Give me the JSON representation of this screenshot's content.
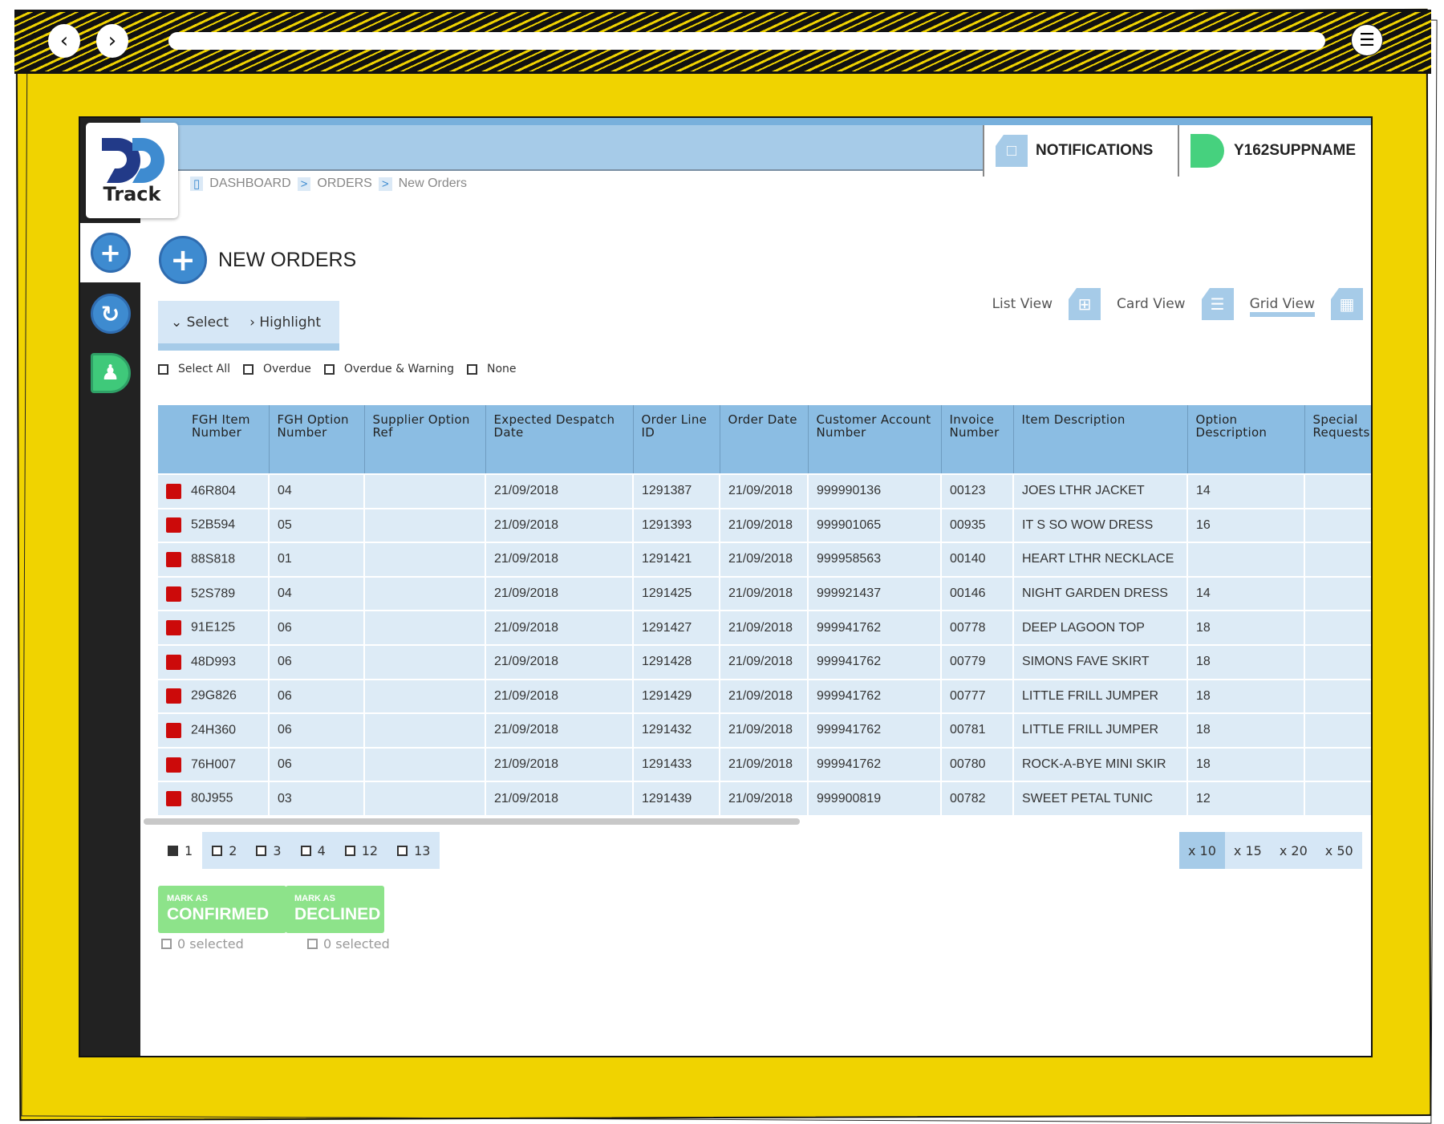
{
  "browser": {
    "back_icon": "chevron-left",
    "forward_icon": "chevron-right",
    "menu_icon": "hamburger"
  },
  "header": {
    "logo_text": "Track",
    "notifications_label": "NOTIFICATIONS",
    "user_label": "Y162SUPPNAME"
  },
  "breadcrumb": [
    "DASHBOARD",
    "ORDERS",
    "New Orders"
  ],
  "page": {
    "title": "NEW ORDERS"
  },
  "toolbar": {
    "select_label": "Select",
    "highlight_label": "Highlight"
  },
  "filters": [
    "Select All",
    "Overdue",
    "Overdue & Warning",
    "None"
  ],
  "views": [
    {
      "label": "List View",
      "active": false
    },
    {
      "label": "Card View",
      "active": false
    },
    {
      "label": "Grid View",
      "active": true
    }
  ],
  "table": {
    "columns": [
      "FGH Item Number",
      "FGH Option Number",
      "Supplier Option Ref",
      "Expected Despatch Date",
      "Order Line ID",
      "Order Date",
      "Customer Account Number",
      "Invoice Number",
      "Item Description",
      "Option Description",
      "Special Requests"
    ],
    "flag_color": "#cc0a0a",
    "rows": [
      [
        "46R804",
        "04",
        "",
        "21/09/2018",
        "1291387",
        "21/09/2018",
        "999990136",
        "00123",
        "JOES LTHR JACKET",
        "14",
        ""
      ],
      [
        "52B594",
        "05",
        "",
        "21/09/2018",
        "1291393",
        "21/09/2018",
        "999901065",
        "00935",
        "IT S SO WOW DRESS",
        "16",
        ""
      ],
      [
        "88S818",
        "01",
        "",
        "21/09/2018",
        "1291421",
        "21/09/2018",
        "999958563",
        "00140",
        "HEART LTHR NECKLACE",
        "",
        ""
      ],
      [
        "52S789",
        "04",
        "",
        "21/09/2018",
        "1291425",
        "21/09/2018",
        "999921437",
        "00146",
        "NIGHT GARDEN DRESS",
        "14",
        ""
      ],
      [
        "91E125",
        "06",
        "",
        "21/09/2018",
        "1291427",
        "21/09/2018",
        "999941762",
        "00778",
        "DEEP LAGOON TOP",
        "18",
        ""
      ],
      [
        "48D993",
        "06",
        "",
        "21/09/2018",
        "1291428",
        "21/09/2018",
        "999941762",
        "00779",
        "SIMONS FAVE SKIRT",
        "18",
        ""
      ],
      [
        "29G826",
        "06",
        "",
        "21/09/2018",
        "1291429",
        "21/09/2018",
        "999941762",
        "00777",
        "LITTLE FRILL JUMPER",
        "18",
        ""
      ],
      [
        "24H360",
        "06",
        "",
        "21/09/2018",
        "1291432",
        "21/09/2018",
        "999941762",
        "00781",
        "LITTLE FRILL JUMPER",
        "18",
        ""
      ],
      [
        "76H007",
        "06",
        "",
        "21/09/2018",
        "1291433",
        "21/09/2018",
        "999941762",
        "00780",
        "ROCK-A-BYE MINI SKIR",
        "18",
        ""
      ],
      [
        "80J955",
        "03",
        "",
        "21/09/2018",
        "1291439",
        "21/09/2018",
        "999900819",
        "00782",
        "SWEET PETAL TUNIC",
        "12",
        ""
      ]
    ]
  },
  "pagination": {
    "current": "1",
    "pages": [
      "2",
      "3",
      "4",
      "12",
      "13"
    ]
  },
  "page_sizes": [
    {
      "label": "x 10",
      "active": true
    },
    {
      "label": "x 15",
      "active": false
    },
    {
      "label": "x 20",
      "active": false
    },
    {
      "label": "x 50",
      "active": false
    }
  ],
  "actions": {
    "confirm": {
      "small": "MARK AS",
      "big": "CONFIRMED",
      "selected": "0 selected"
    },
    "decline": {
      "small": "MARK AS",
      "big": "DECLINED",
      "selected": "0 selected"
    }
  }
}
